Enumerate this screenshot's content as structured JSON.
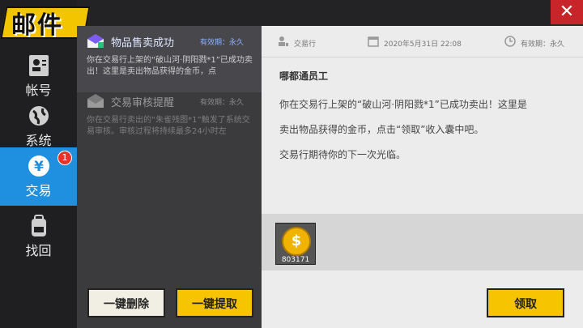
{
  "window": {
    "title": "邮件",
    "close_label": "✕"
  },
  "categories": [
    {
      "label": "帐号",
      "icon": "id-card-icon",
      "active": false
    },
    {
      "label": "系统",
      "icon": "globe-icon",
      "active": false
    },
    {
      "label": "交易",
      "icon": "yen-icon",
      "active": true,
      "badge": "1"
    },
    {
      "label": "找回",
      "icon": "backpack-icon",
      "active": false
    }
  ],
  "mails": [
    {
      "subject": "物品售卖成功",
      "expiry": "有效期：永久",
      "preview": "你在交易行上架的“破山河·阴阳戮*1”已成功卖出！这里是卖出物品获得的金币，点",
      "selected": true
    },
    {
      "subject": "交易审核提醒",
      "expiry": "有效期：永久",
      "preview": "你在交易行卖出的“朱雀残图*1”触发了系统交易审核。审核过程将持续最多24小时左",
      "selected": false
    }
  ],
  "buttons": {
    "delete_all": "一键删除",
    "claim_all": "一键提取",
    "claim": "领取"
  },
  "detail": {
    "sender": "交易行",
    "date": "2020年5月31日 22:08",
    "expiry": "有效期：永久",
    "title": "哪都通员工",
    "body_lines": [
      "你在交易行上架的“破山河·阴阳戮*1”已成功卖出！这里是",
      "卖出物品获得的金币，点击“领取”收入囊中吧。",
      "交易行期待你的下一次光临。"
    ],
    "attachment": {
      "icon": "gold-coin-icon",
      "quantity": "803171"
    }
  }
}
